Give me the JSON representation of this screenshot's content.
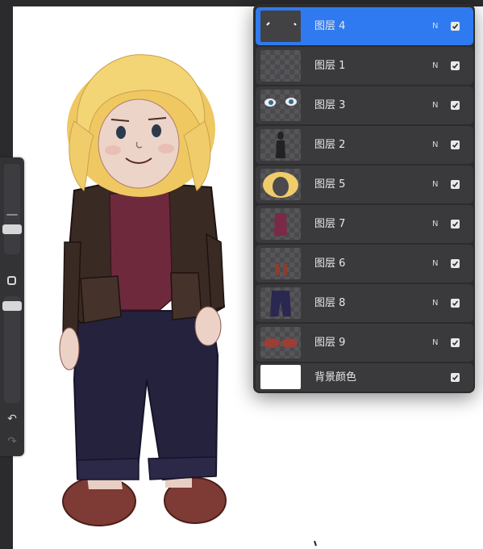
{
  "layers": [
    {
      "name": "图层 4",
      "mode": "N",
      "visible": true,
      "selected": true,
      "thumb": "eye-highlights"
    },
    {
      "name": "图层 1",
      "mode": "N",
      "visible": true,
      "selected": false,
      "thumb": "sketch"
    },
    {
      "name": "图层 3",
      "mode": "N",
      "visible": true,
      "selected": false,
      "thumb": "eyes"
    },
    {
      "name": "图层 2",
      "mode": "N",
      "visible": true,
      "selected": false,
      "thumb": "figure-outline"
    },
    {
      "name": "图层 5",
      "mode": "N",
      "visible": true,
      "selected": false,
      "thumb": "hair"
    },
    {
      "name": "图层 7",
      "mode": "N",
      "visible": true,
      "selected": false,
      "thumb": "shirt"
    },
    {
      "name": "图层 6",
      "mode": "N",
      "visible": true,
      "selected": false,
      "thumb": "boots"
    },
    {
      "name": "图层 8",
      "mode": "N",
      "visible": true,
      "selected": false,
      "thumb": "pants"
    },
    {
      "name": "图层 9",
      "mode": "N",
      "visible": true,
      "selected": false,
      "thumb": "shoes"
    }
  ],
  "background_layer": {
    "name": "背景颜色",
    "visible": true,
    "color": "#ffffff"
  },
  "colors": {
    "selected": "#2f7af0",
    "panel": "#2c2c2e",
    "row": "#3a3a3c",
    "hair": "#f0cf6a",
    "jacket": "#3a2a24",
    "shirt": "#6e2a3c",
    "pants": "#24223d",
    "shoes": "#8a3e36"
  },
  "sidebar": {
    "icons": [
      "modify-icon",
      "undo-icon",
      "redo-icon"
    ],
    "brush_size": 0.25,
    "opacity": 0.95
  }
}
